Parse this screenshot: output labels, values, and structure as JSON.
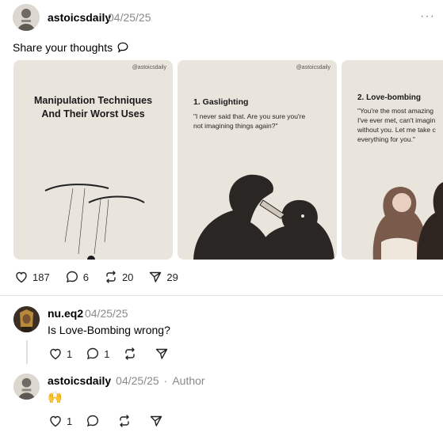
{
  "post": {
    "username": "astoicsdaily",
    "date": "04/25/25",
    "more": "···",
    "text": "Share your thoughts",
    "cards": [
      {
        "handle": "@astoicsdaily",
        "title_line1": "Manipulation Techniques",
        "title_line2": "And Their Worst Uses"
      },
      {
        "handle": "@astoicsdaily",
        "title": "1. Gaslighting",
        "quote_line1": "\"I never said that. Are you sure you're",
        "quote_line2": "not imagining things again?\""
      },
      {
        "title": "2. Love-bombing",
        "quote_line1": "\"You're the most amazing",
        "quote_line2": "I've ever met, can't imagin",
        "quote_line3": "without you. Let me take c",
        "quote_line4": "everything for you.\""
      }
    ],
    "stats": {
      "likes": "187",
      "replies": "6",
      "reposts": "20",
      "shares": "29"
    }
  },
  "reply": {
    "username": "nu.eq2",
    "date": "04/25/25",
    "more": "···",
    "text": "Is Love-Bombing wrong?",
    "stats": {
      "likes": "1",
      "replies": "1"
    }
  },
  "author_reply": {
    "username": "astoicsdaily",
    "date": "04/25/25",
    "separator": "·",
    "author_label": "Author",
    "more": "···",
    "text": "🙌",
    "stats": {
      "likes": "1"
    }
  },
  "icons": {
    "heart": "heart-icon",
    "reply": "reply-bubble-icon",
    "repost": "repost-icon",
    "share": "share-icon"
  },
  "colors": {
    "muted": "#8a8a8a",
    "card_bg": "#e9e4dc"
  }
}
